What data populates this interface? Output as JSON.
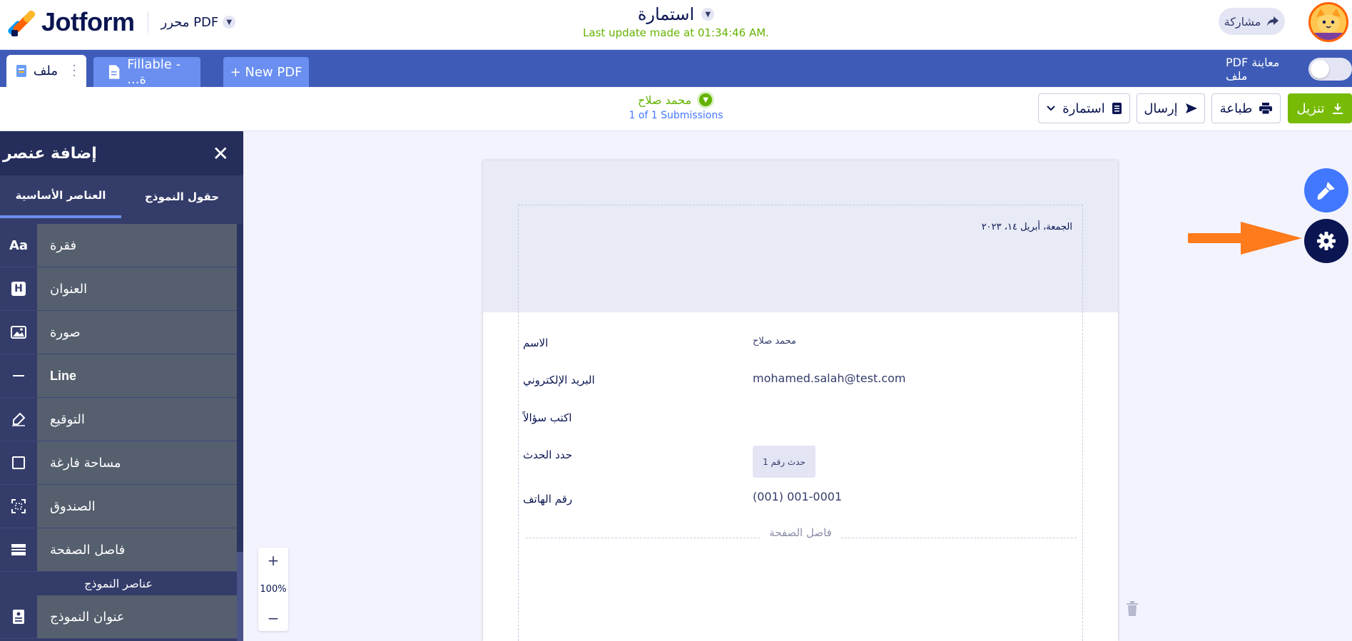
{
  "header": {
    "brand": "Jotform",
    "editor_label": "محرر PDF",
    "form_title": "استمارة",
    "last_update": "Last update made at 01:34:46 AM.",
    "share_label": "مشاركة"
  },
  "tabs": {
    "file_tab": "ملف",
    "fillable_tab": "Fillable - ...ة",
    "new_pdf": "+ New PDF",
    "pdf_preview_label": "PDF معاينة ملف"
  },
  "actions": {
    "submitter_name": "محمد صلاح",
    "submission_count": "1 of 1 Submissions",
    "download": "تنزيل",
    "print": "طباعة",
    "send": "إرسال",
    "form_select": "استمارة"
  },
  "panel": {
    "title": "إضافة عنصر",
    "tab_form_fields": "حقول النموذج",
    "tab_basic": "العناصر الأساسية",
    "items": [
      {
        "icon": "Aa",
        "label": "فقرة"
      },
      {
        "icon": "H",
        "label": "العنوان"
      },
      {
        "icon": "image",
        "label": "صورة"
      },
      {
        "icon": "line",
        "label": "Line"
      },
      {
        "icon": "pen",
        "label": "التوقيع"
      },
      {
        "icon": "square",
        "label": "مساحة فارغة"
      },
      {
        "icon": "box",
        "label": "الصندوق"
      },
      {
        "icon": "page-break",
        "label": "فاصل الصفحة"
      }
    ],
    "section_label": "عناصر النموذج",
    "section_items": [
      {
        "icon": "form-title",
        "label": "عنوان النموذج"
      }
    ]
  },
  "zoom": {
    "plus": "+",
    "level": "100%",
    "minus": "−"
  },
  "document": {
    "date": "الجمعة، أبريل ١٤، ٢٠٢٣",
    "rows": [
      {
        "label": "الاسم",
        "value": "محمد صلاح"
      },
      {
        "label": "البريد الإلكتروني",
        "value": "mohamed.salah@test.com"
      },
      {
        "label": "اكتب سؤالاً",
        "value": ""
      },
      {
        "label": "حدد الحدث",
        "value": "حدث رقم 1"
      },
      {
        "label": "رقم الهاتف",
        "value": "(001) 001-0001"
      }
    ],
    "page_break": "فاصل الصفحة"
  },
  "colors": {
    "brand_navy": "#0a1551",
    "tab_blue": "#3e5cb7",
    "green": "#78bb07",
    "panel_dark": "#343c6a",
    "accent_orange": "#ff7b1c"
  }
}
